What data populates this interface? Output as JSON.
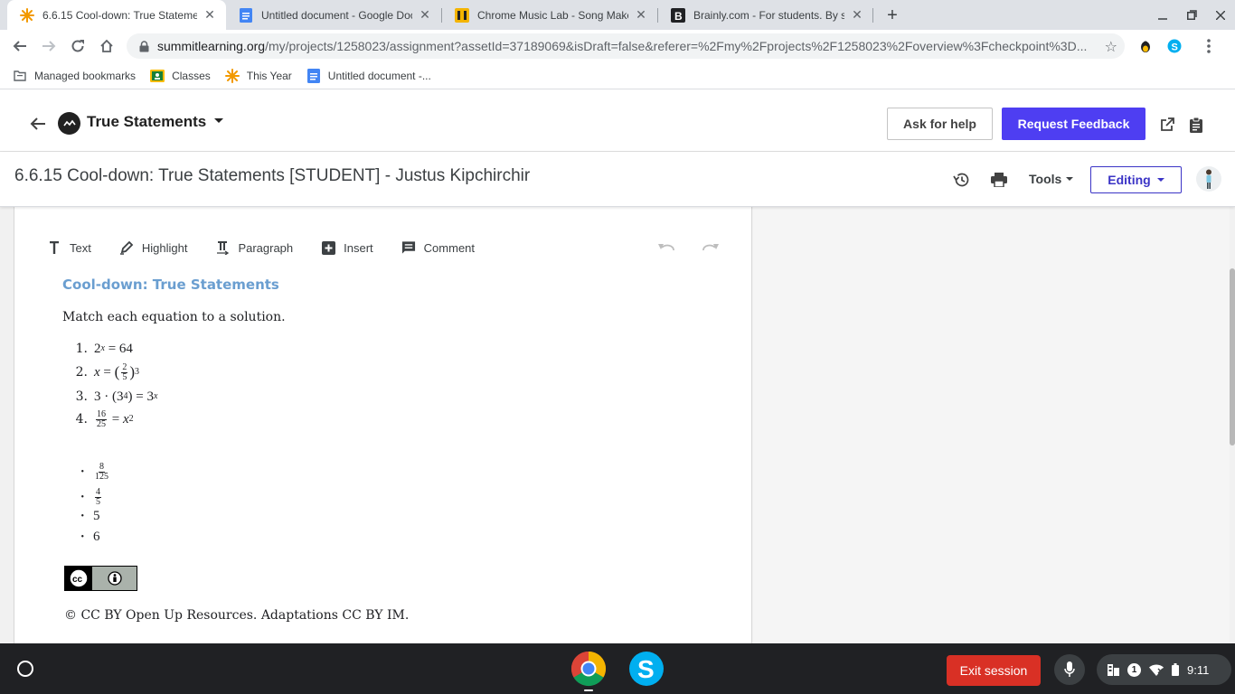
{
  "browser": {
    "tabs": [
      {
        "title": "6.6.15 Cool-down: True Stateme",
        "icon": "summit-star-icon",
        "active": true
      },
      {
        "title": "Untitled document - Google Doc",
        "icon": "google-docs-icon",
        "active": false
      },
      {
        "title": "Chrome Music Lab - Song Maker",
        "icon": "music-lab-icon",
        "active": false
      },
      {
        "title": "Brainly.com - For students. By st",
        "icon": "brainly-icon",
        "active": false
      }
    ],
    "close_glyph": "✕",
    "new_tab_glyph": "+",
    "url_domain": "summitlearning.org",
    "url_path": "/my/projects/1258023/assignment?assetId=37189069&isDraft=false&referer=%2Fmy%2Fprojects%2F1258023%2Foverview%3Fcheckpoint%3D..."
  },
  "bookmarks": [
    {
      "label": "Managed bookmarks",
      "icon": "folder-icon"
    },
    {
      "label": "Classes",
      "icon": "classes-icon"
    },
    {
      "label": "This Year",
      "icon": "summit-star-icon"
    },
    {
      "label": "Untitled document -...",
      "icon": "google-docs-icon"
    }
  ],
  "app_header": {
    "project_title": "True Statements",
    "help_label": "Ask for help",
    "feedback_label": "Request Feedback"
  },
  "doc_header": {
    "title": "6.6.15 Cool-down: True Statements [STUDENT] - Justus Kipchirchir",
    "tools_label": "Tools",
    "editing_label": "Editing"
  },
  "editor_toolbar": {
    "text": "Text",
    "highlight": "Highlight",
    "paragraph": "Paragraph",
    "insert": "Insert",
    "comment": "Comment"
  },
  "document": {
    "heading": "Cool-down: True Statements",
    "instruction": "Match each equation to a solution.",
    "equation_numbers": [
      "1.",
      "2.",
      "3.",
      "4."
    ],
    "solutions": [
      "5",
      "6"
    ],
    "solution_bullet": "•",
    "attribution": "© CC BY Open Up Resources. Adaptations CC BY IM."
  },
  "shelf": {
    "exit_label": "Exit session",
    "notification_count": "1",
    "time": "9:11"
  },
  "colors": {
    "accent_purple": "#4e3ef2",
    "editing_purple": "#3b34c6",
    "heading_blue": "#6a9ed0",
    "exit_red": "#d93025"
  }
}
